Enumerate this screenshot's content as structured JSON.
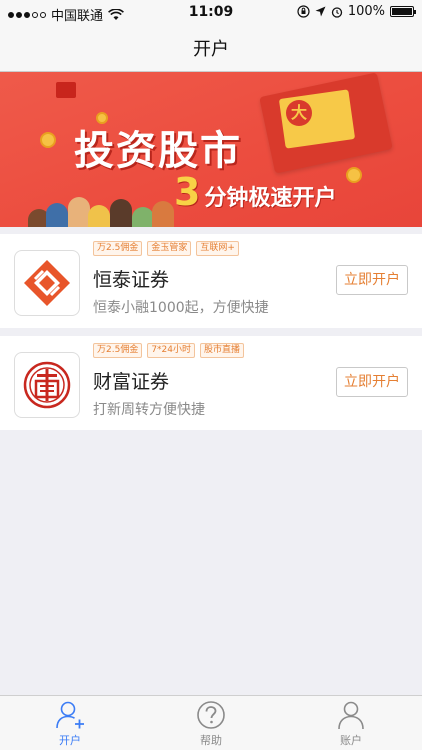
{
  "status_bar": {
    "carrier": "中国联通",
    "time": "11:09",
    "battery": "100%",
    "battery_level": 1.0,
    "signal_bars_filled": 3,
    "signal_bars_total": 5
  },
  "nav": {
    "title": "开户"
  },
  "banner": {
    "title": "投资股市",
    "subtitle_number": "3",
    "subtitle_text": "分钟极速开户",
    "seal_text": "大"
  },
  "brokers": [
    {
      "name": "恒泰证券",
      "tags": [
        "万2.5佣金",
        "金玉管家",
        "互联网+"
      ],
      "description": "恒泰小融1000起，方便快捷",
      "button_label": "立即开户",
      "logo_icon": "hengtai-logo-icon"
    },
    {
      "name": "财富证券",
      "tags": [
        "万2.5佣金",
        "7*24小时",
        "股市直播"
      ],
      "description": "打新周转方便快捷",
      "button_label": "立即开户",
      "logo_icon": "caifu-logo-icon"
    }
  ],
  "tab_bar": {
    "items": [
      {
        "label": "开户",
        "icon": "add-user-icon",
        "active": true
      },
      {
        "label": "帮助",
        "icon": "help-icon",
        "active": false
      },
      {
        "label": "账户",
        "icon": "account-icon",
        "active": false
      }
    ]
  },
  "colors": {
    "accent": "#3b7cf5",
    "banner_red": "#ec4d3f",
    "tag_orange": "#e57f33",
    "logo_red": "#c8281f"
  }
}
